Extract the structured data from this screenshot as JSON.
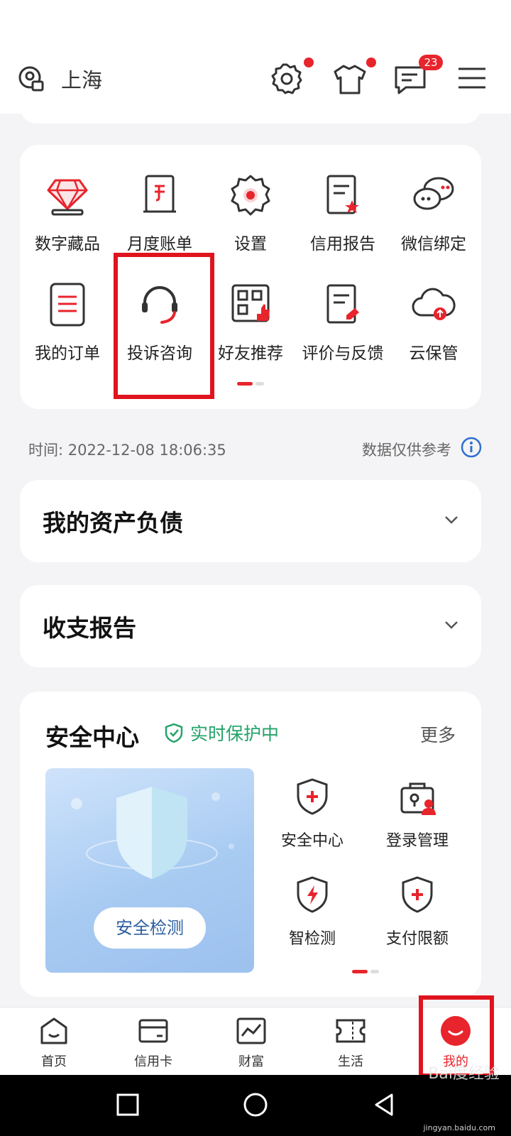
{
  "header": {
    "location": "上海",
    "messages_badge": "23"
  },
  "services": {
    "items": [
      {
        "label": "数字藏品",
        "icon": "diamond-icon"
      },
      {
        "label": "月度账单",
        "icon": "monthly-bill-icon"
      },
      {
        "label": "设置",
        "icon": "settings-gear-icon"
      },
      {
        "label": "信用报告",
        "icon": "credit-report-icon"
      },
      {
        "label": "微信绑定",
        "icon": "wechat-chat-icon"
      },
      {
        "label": "我的订单",
        "icon": "clipboard-icon"
      },
      {
        "label": "投诉咨询",
        "icon": "headset-icon"
      },
      {
        "label": "好友推荐",
        "icon": "qrcode-thumb-icon"
      },
      {
        "label": "评价与反馈",
        "icon": "feedback-doc-icon"
      },
      {
        "label": "云保管",
        "icon": "cloud-upload-icon"
      }
    ]
  },
  "info": {
    "time": "时间: 2022-12-08 18:06:35",
    "disclaimer": "数据仅供参考"
  },
  "sections": {
    "assets": "我的资产负债",
    "report": "收支报告"
  },
  "security": {
    "title": "安全中心",
    "status": "实时保护中",
    "more": "更多",
    "check_button": "安全检测",
    "items": [
      {
        "label": "安全中心",
        "icon": "shield-plus-icon"
      },
      {
        "label": "登录管理",
        "icon": "lock-user-icon"
      },
      {
        "label": "智检测",
        "icon": "shield-lightning-icon"
      },
      {
        "label": "支付限额",
        "icon": "shield-plus-icon"
      }
    ]
  },
  "tabbar": {
    "items": [
      {
        "label": "首页",
        "icon": "home-icon"
      },
      {
        "label": "信用卡",
        "icon": "credit-card-icon"
      },
      {
        "label": "财富",
        "icon": "chart-line-icon"
      },
      {
        "label": "生活",
        "icon": "ticket-icon"
      },
      {
        "label": "我的",
        "icon": "profile-smile-icon"
      }
    ],
    "active": "我的"
  },
  "colors": {
    "accent": "#e8242c",
    "highlight": "#e0141e",
    "safe": "#24a36a"
  },
  "watermark": {
    "brand": "Bai度经验",
    "url": "jingyan.baidu.com"
  }
}
